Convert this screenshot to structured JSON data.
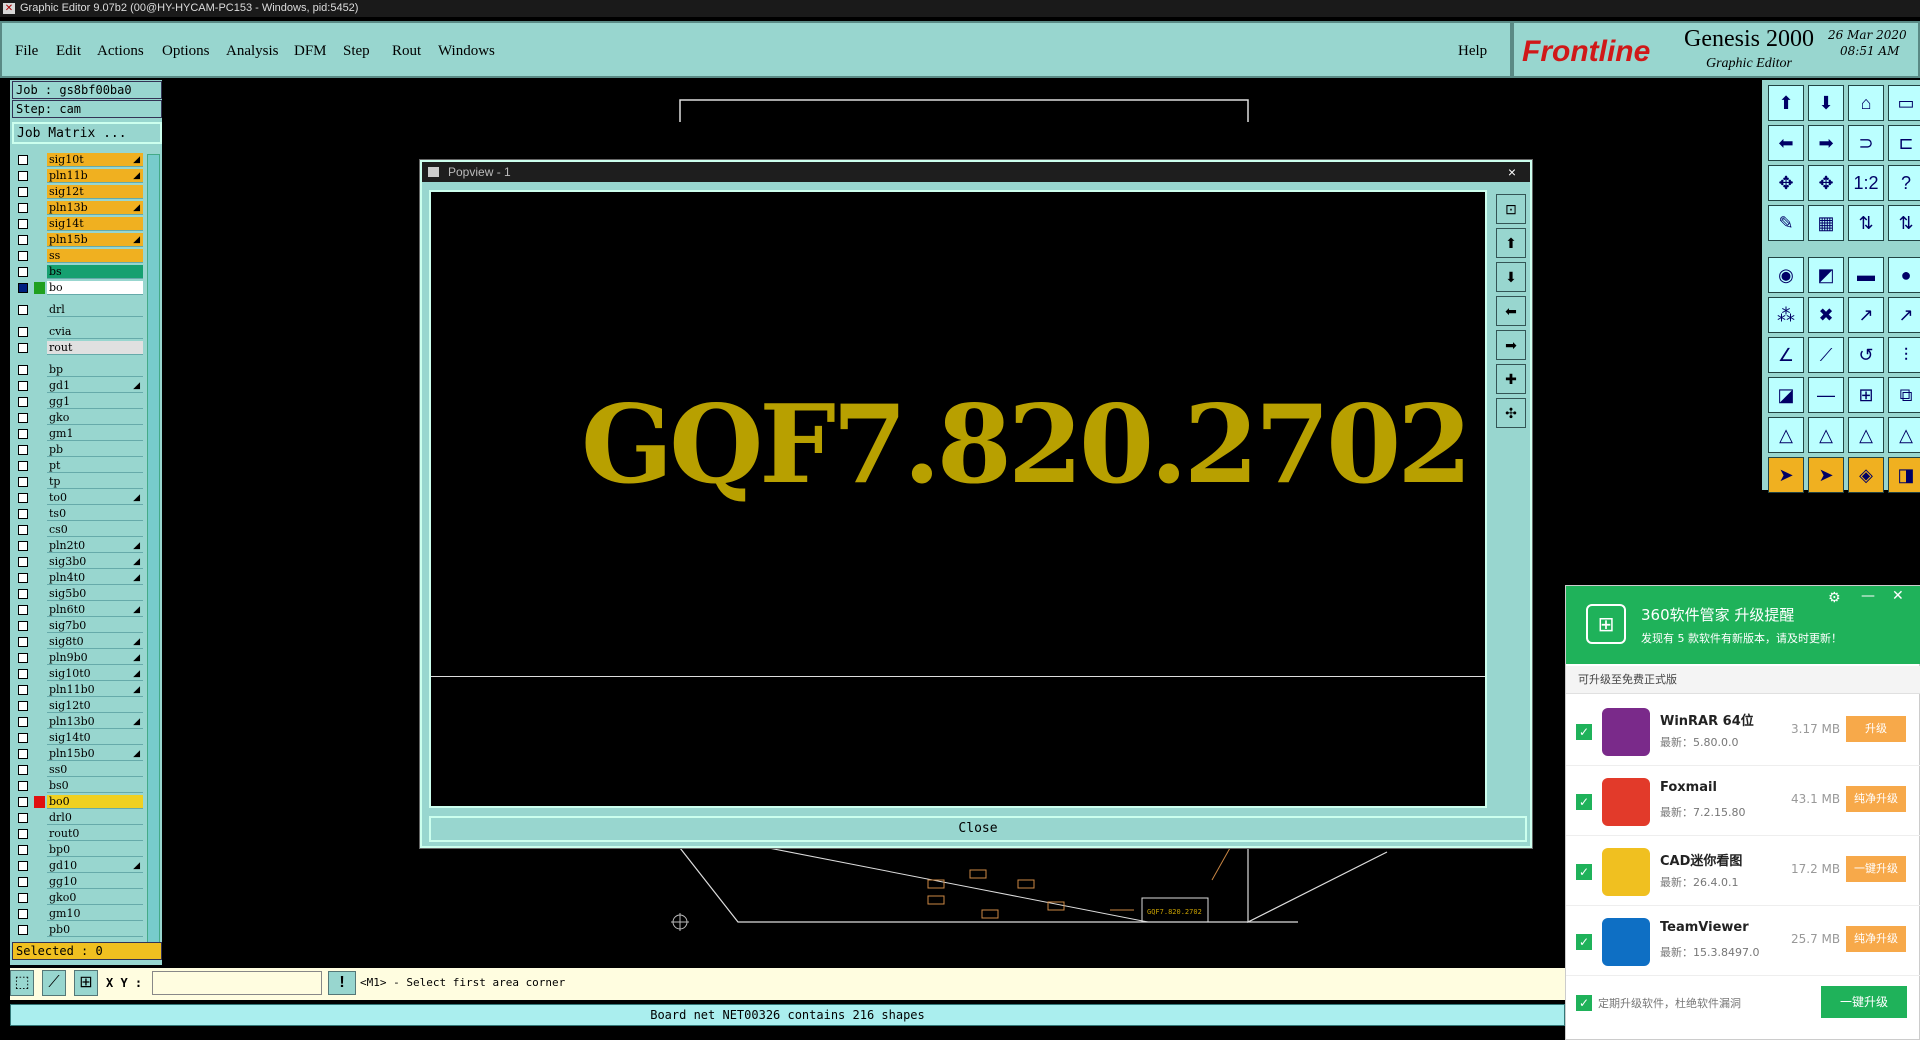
{
  "titlebar": {
    "text": "Graphic Editor 9.07b2 (00@HY-HYCAM-PC153 - Windows, pid:5452)"
  },
  "menu": {
    "items": [
      "File",
      "Edit",
      "Actions",
      "Options",
      "Analysis",
      "DFM",
      "Step",
      "Rout",
      "Windows"
    ],
    "help": "Help"
  },
  "logo": {
    "brand": "Frontline",
    "product": "Genesis 2000",
    "subtitle": "Graphic Editor",
    "date": "26 Mar 2020",
    "time": "08:51 AM"
  },
  "side": {
    "job": "Job : gs8bf00ba0",
    "step": "Step: cam",
    "matrix": "Job Matrix ...",
    "selected": "Selected : 0"
  },
  "layers": [
    {
      "name": "sig10t",
      "color": "#f0b020",
      "arrow": true
    },
    {
      "name": "pln11b",
      "color": "#f0b020",
      "arrow": true
    },
    {
      "name": "sig12t",
      "color": "#f0b020",
      "arrow": false
    },
    {
      "name": "pln13b",
      "color": "#f0b020",
      "arrow": true
    },
    {
      "name": "sig14t",
      "color": "#f0b020",
      "arrow": false
    },
    {
      "name": "pln15b",
      "color": "#f0b020",
      "arrow": true
    },
    {
      "name": "ss",
      "color": "#f0b020",
      "arrow": false
    },
    {
      "name": "bs",
      "color": "#16a070",
      "arrow": false
    },
    {
      "name": "bo",
      "color": "#ffffff",
      "arrow": false
    },
    {
      "name": "drl",
      "color": "#98d6cf",
      "arrow": false
    },
    {
      "name": "cvia",
      "color": "#98d6cf",
      "arrow": false
    },
    {
      "name": "rout",
      "color": "#e0e0e0",
      "arrow": false
    },
    {
      "name": "bp",
      "color": "#98d6cf",
      "arrow": false
    },
    {
      "name": "gd1",
      "color": "#98d6cf",
      "arrow": true
    },
    {
      "name": "gg1",
      "color": "#98d6cf",
      "arrow": false
    },
    {
      "name": "gko",
      "color": "#98d6cf",
      "arrow": false
    },
    {
      "name": "gm1",
      "color": "#98d6cf",
      "arrow": false
    },
    {
      "name": "pb",
      "color": "#98d6cf",
      "arrow": false
    },
    {
      "name": "pt",
      "color": "#98d6cf",
      "arrow": false
    },
    {
      "name": "tp",
      "color": "#98d6cf",
      "arrow": false
    },
    {
      "name": "to0",
      "color": "#98d6cf",
      "arrow": true
    },
    {
      "name": "ts0",
      "color": "#98d6cf",
      "arrow": false
    },
    {
      "name": "cs0",
      "color": "#98d6cf",
      "arrow": false
    },
    {
      "name": "pln2t0",
      "color": "#98d6cf",
      "arrow": true
    },
    {
      "name": "sig3b0",
      "color": "#98d6cf",
      "arrow": true
    },
    {
      "name": "pln4t0",
      "color": "#98d6cf",
      "arrow": true
    },
    {
      "name": "sig5b0",
      "color": "#98d6cf",
      "arrow": false
    },
    {
      "name": "pln6t0",
      "color": "#98d6cf",
      "arrow": true
    },
    {
      "name": "sig7b0",
      "color": "#98d6cf",
      "arrow": false
    },
    {
      "name": "sig8t0",
      "color": "#98d6cf",
      "arrow": true
    },
    {
      "name": "pln9b0",
      "color": "#98d6cf",
      "arrow": true
    },
    {
      "name": "sig10t0",
      "color": "#98d6cf",
      "arrow": true
    },
    {
      "name": "pln11b0",
      "color": "#98d6cf",
      "arrow": true
    },
    {
      "name": "sig12t0",
      "color": "#98d6cf",
      "arrow": false
    },
    {
      "name": "pln13b0",
      "color": "#98d6cf",
      "arrow": true
    },
    {
      "name": "sig14t0",
      "color": "#98d6cf",
      "arrow": false
    },
    {
      "name": "pln15b0",
      "color": "#98d6cf",
      "arrow": true
    },
    {
      "name": "ss0",
      "color": "#98d6cf",
      "arrow": false
    },
    {
      "name": "bs0",
      "color": "#98d6cf",
      "arrow": false
    },
    {
      "name": "bo0",
      "color": "#98d6cf",
      "arrow": false
    },
    {
      "name": "drl0",
      "color": "#98d6cf",
      "arrow": false
    },
    {
      "name": "rout0",
      "color": "#98d6cf",
      "arrow": false
    },
    {
      "name": "bp0",
      "color": "#98d6cf",
      "arrow": false
    },
    {
      "name": "gd10",
      "color": "#98d6cf",
      "arrow": true
    },
    {
      "name": "gg10",
      "color": "#98d6cf",
      "arrow": false
    },
    {
      "name": "gko0",
      "color": "#98d6cf",
      "arrow": false
    },
    {
      "name": "gm10",
      "color": "#98d6cf",
      "arrow": false
    },
    {
      "name": "pb0",
      "color": "#98d6cf",
      "arrow": false
    }
  ],
  "popup": {
    "title": "Popview - 1",
    "close_x": "×",
    "text": "GQF7.820.2702",
    "close_label": "Close"
  },
  "canvas": {
    "label": "GQF7.820.2702"
  },
  "status": {
    "xy_label": "X Y :",
    "xy_value": "",
    "prompt": "<M1> - Select first area corner",
    "message": "Board net NET00326 contains 216 shapes"
  },
  "notif": {
    "title": "360软件管家 升级提醒",
    "subtitle": "发现有 5 款软件有新版本，请及时更新！",
    "section": "可升级至免费正式版",
    "items": [
      {
        "name": "WinRAR 64位",
        "version": "最新：5.80.0.0",
        "size": "3.17 MB",
        "button": "升级",
        "icon": "#7a2a8a"
      },
      {
        "name": "Foxmail",
        "version": "最新：7.2.15.80",
        "size": "43.1 MB",
        "button": "纯净升级",
        "icon": "#e23a2a"
      },
      {
        "name": "CAD迷你看图",
        "version": "最新：26.4.0.1",
        "size": "17.2 MB",
        "button": "一键升级",
        "icon": "#f0c020"
      },
      {
        "name": "TeamViewer",
        "version": "最新：15.3.8497.0",
        "size": "25.7 MB",
        "button": "纯净升级",
        "icon": "#0e6fc4"
      }
    ],
    "footer_check": "定期升级软件，杜绝软件漏洞",
    "footer_button": "一键升级",
    "settings": "⚙",
    "minimize": "—",
    "close": "✕"
  }
}
